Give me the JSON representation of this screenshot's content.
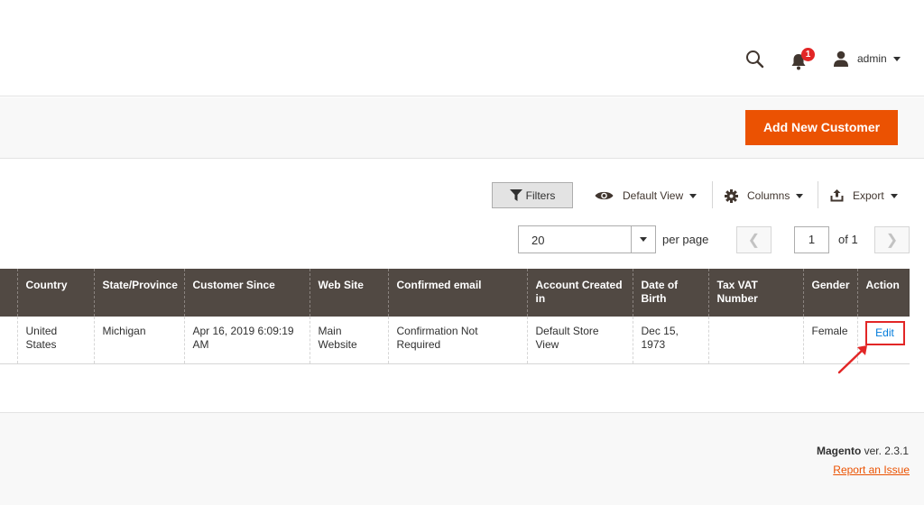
{
  "header": {
    "notification_count": "1",
    "user_label": "admin"
  },
  "actions": {
    "add_new_customer": "Add New Customer"
  },
  "toolbar": {
    "filters_label": "Filters",
    "view_label": "Default View",
    "columns_label": "Columns",
    "export_label": "Export"
  },
  "pagination": {
    "per_page_value": "20",
    "per_page_label": "per page",
    "current_page": "1",
    "of_label": "of 1"
  },
  "grid": {
    "columns": [
      "",
      "Country",
      "State/Province",
      "Customer Since",
      "Web Site",
      "Confirmed email",
      "Account Created in",
      "Date of Birth",
      "Tax VAT Number",
      "Gender",
      "Action"
    ],
    "rows": [
      {
        "country": "United States",
        "state": "Michigan",
        "customer_since": "Apr 16, 2019 6:09:19 AM",
        "website": "Main Website",
        "confirmed_email": "Confirmation Not Required",
        "account_created_in": "Default Store View",
        "date_of_birth": "Dec 15, 1973",
        "tax_vat": "",
        "gender": "Female",
        "action": "Edit"
      }
    ]
  },
  "footer": {
    "brand": "Magento",
    "version": " ver. 2.3.1",
    "report_issue": "Report an Issue"
  },
  "colors": {
    "accent": "#eb5202",
    "grid_header": "#514943",
    "link": "#007bdb",
    "highlight": "#e22626"
  }
}
